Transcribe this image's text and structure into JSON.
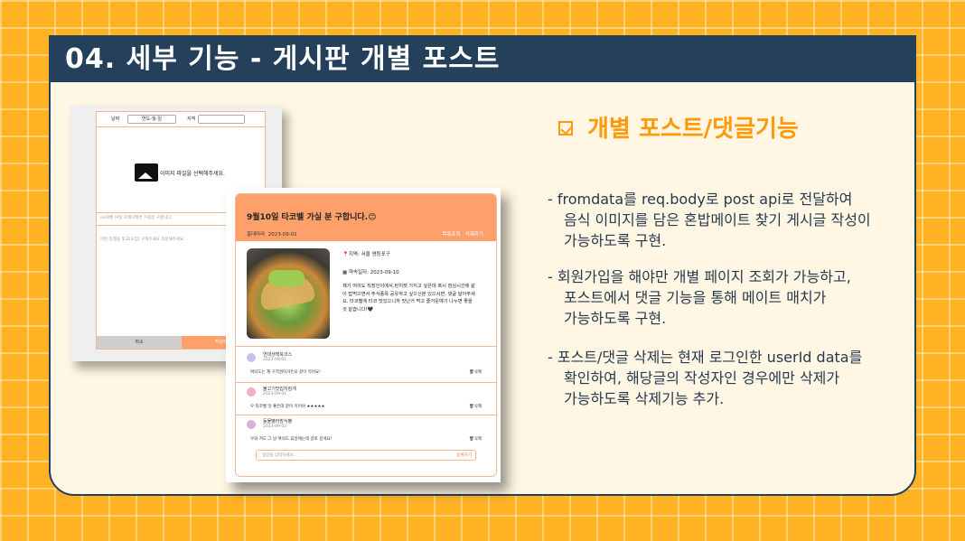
{
  "title": "04. 세부 기능 - 게시판 개별 포스트",
  "form": {
    "date_label": "날짜",
    "date_value": "연도-월-일",
    "place_label": "지역",
    "image_prompt": "이미지 파일을 선택해주세요.",
    "field_title": "ex)9월 (9일 오레나레면 가실분 구합니다.",
    "field_body": "어떤 동행을 찾고(모집) 구해주세요 작성해주세요.",
    "cancel_label": "취소",
    "submit_label": "작성하기"
  },
  "post": {
    "title": "9월10일 타코벨 가실 분 구합니다.😊",
    "author": "홍대마라",
    "date": "2023-09-01",
    "actions": [
      "목록조회",
      "삭제하기"
    ],
    "location_label": "지역:",
    "location_value": "서울 영등포구",
    "meet_label": "약속일자:",
    "meet_value": "2023-09-10",
    "body": "제가 여의도 직장인이에서,런치켓 가지고 싶은데 혹시 점심시간에 같이 밥먹으면서 주식종목 공유하고 싶으신분 있으시면, 댓글 달아주세요. 타코벨에 타코 맛있으니까 맛난거 먹고 즐거운얘기 나누면 좋을 것 같습니다!🖤",
    "comments": [
      {
        "name": "연대생책북코스",
        "date": "2023-09-01",
        "text": "여의도는 제 구역권이거든요 같이 먹어요!",
        "delete": "삭제"
      },
      {
        "name": "불고기맛집지킴개",
        "date": "2023-09-01",
        "text": "우 타코벨 맛 좋은데 같이 먹어야 ★★★★★",
        "delete": "삭제"
      },
      {
        "name": "동물빵러밤식빵",
        "date": "2023-09-02",
        "text": "우와 저도 그 날 여의도 휴일에는데 글로 갈게요!",
        "delete": "삭제"
      }
    ],
    "comment_placeholder": "댓글을 입력하세요...",
    "comment_submit": "등록하기"
  },
  "feature": {
    "heading": "개별 포스트/댓글기능",
    "bullets": [
      [
        "- fromdata를 req.body로 post api로 전달하여",
        "음식 이미지를 담은 혼밥메이트 찾기 게시글 작성이",
        "가능하도록 구현."
      ],
      [
        "- 회원가입을 해야만 개별 페이지 조회가 가능하고,",
        "포스트에서 댓글 기능을 통해 메이트 매치가",
        "가능하도록 구현."
      ],
      [
        "- 포스트/댓글 삭제는 현재 로그인한 userId data를",
        "확인하여, 해당글의 작성자인 경우에만 삭제가",
        "가능하도록  삭제기능 추가."
      ]
    ]
  },
  "colors": {
    "accent": "#ff9a0a",
    "navy": "#24405a",
    "peach": "#ffa06a",
    "background": "#ffb224"
  }
}
